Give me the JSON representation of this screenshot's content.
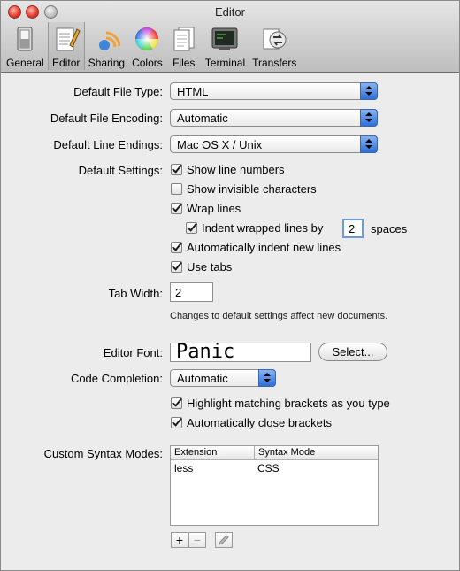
{
  "window": {
    "title": "Editor"
  },
  "toolbar": {
    "items": [
      {
        "label": "General"
      },
      {
        "label": "Editor"
      },
      {
        "label": "Sharing"
      },
      {
        "label": "Colors"
      },
      {
        "label": "Files"
      },
      {
        "label": "Terminal"
      },
      {
        "label": "Transfers"
      }
    ],
    "selected": "Editor"
  },
  "form": {
    "file_type": {
      "label": "Default File Type:",
      "value": "HTML"
    },
    "file_encoding": {
      "label": "Default File Encoding:",
      "value": "Automatic"
    },
    "line_endings": {
      "label": "Default Line Endings:",
      "value": "Mac OS X / Unix"
    },
    "settings_label": "Default Settings:",
    "checkboxes": {
      "show_line_numbers": {
        "label": "Show line numbers",
        "checked": true
      },
      "show_invisible": {
        "label": "Show invisible characters",
        "checked": false
      },
      "wrap_lines": {
        "label": "Wrap lines",
        "checked": true
      },
      "indent_wrapped": {
        "label": "Indent wrapped lines by",
        "checked": true,
        "value": "2",
        "suffix": "spaces"
      },
      "auto_indent": {
        "label": "Automatically indent new lines",
        "checked": true
      },
      "use_tabs": {
        "label": "Use tabs",
        "checked": true
      }
    },
    "tab_width": {
      "label": "Tab Width:",
      "value": "2"
    },
    "hint": "Changes to default settings affect new documents.",
    "editor_font": {
      "label": "Editor Font:",
      "value": "Panic",
      "button": "Select..."
    },
    "code_completion": {
      "label": "Code Completion:",
      "value": "Automatic"
    },
    "brackets": {
      "highlight": {
        "label": "Highlight matching brackets as you type",
        "checked": true
      },
      "autoclose": {
        "label": "Automatically close brackets",
        "checked": true
      }
    },
    "syntax_modes": {
      "label": "Custom Syntax Modes:",
      "columns": [
        "Extension",
        "Syntax Mode"
      ],
      "rows": [
        {
          "extension": "less",
          "mode": "CSS"
        }
      ],
      "add": "+",
      "remove": "−"
    }
  }
}
